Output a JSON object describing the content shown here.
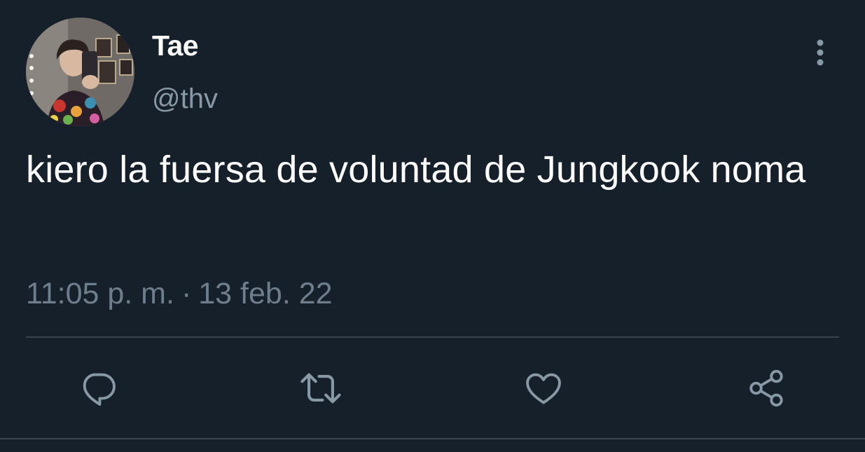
{
  "user": {
    "display_name": "Tae",
    "handle": "@thv",
    "avatar": "user-avatar-photo"
  },
  "tweet": {
    "text": "kiero la fuersa de voluntad de Jungkook noma",
    "time": "11:05 p. m.",
    "separator": "·",
    "date": "13 feb. 22"
  },
  "icons": {
    "more": "more-vertical-icon",
    "reply": "reply-icon",
    "retweet": "retweet-icon",
    "like": "heart-icon",
    "share": "share-icon"
  },
  "colors": {
    "background": "#15202b",
    "text_primary": "#ffffff",
    "text_secondary": "#8899a6",
    "icon": "#8899a6",
    "divider": "#38444d"
  }
}
